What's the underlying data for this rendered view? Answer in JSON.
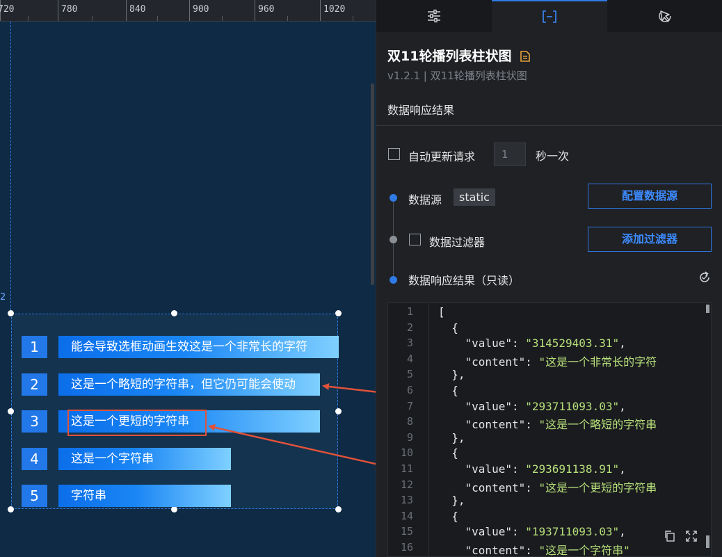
{
  "ruler": {
    "ticks": [
      "720",
      "780",
      "840",
      "900",
      "960",
      "1020"
    ],
    "side_label": "2"
  },
  "chart_data": {
    "type": "bar",
    "title": "",
    "categories": [
      "1",
      "2",
      "3",
      "4",
      "5"
    ],
    "labels": [
      "能会导致选框动画生效这是一个非常长的字符",
      "这是一个略短的字符串，但它仍可能会使动",
      "这是一个更短的字符串",
      "这是一个字符串",
      "字符串"
    ],
    "values": [
      314529403.31,
      293711093.03,
      293691138.91,
      193711093.03,
      193711093.03
    ]
  },
  "panel": {
    "tabs": [
      {
        "name": "style",
        "icon": "sliders-icon"
      },
      {
        "name": "data",
        "icon": "data-bracket-icon"
      },
      {
        "name": "interaction",
        "icon": "cursor-icon"
      }
    ],
    "title": "双11轮播列表柱状图",
    "subtitle": "v1.2.1 | 双11轮播列表柱状图",
    "section_title": "数据响应结果",
    "auto_update_label": "自动更新请求",
    "auto_update_value": "1",
    "auto_update_unit": "秒一次",
    "datasource_label": "数据源",
    "datasource_tag": "static",
    "config_datasource_btn": "配置数据源",
    "filter_label": "数据过滤器",
    "add_filter_btn": "添加过滤器",
    "response_label": "数据响应结果（只读）",
    "colors": {
      "accent": "#2f7ae5",
      "string": "#b7e07a"
    }
  },
  "code_lines": [
    {
      "n": "1",
      "parts": [
        {
          "t": "[",
          "c": "k"
        }
      ]
    },
    {
      "n": "2",
      "parts": [
        {
          "t": "  {",
          "c": "k"
        }
      ]
    },
    {
      "n": "3",
      "parts": [
        {
          "t": "    \"value\": ",
          "c": "k"
        },
        {
          "t": "\"314529403.31\"",
          "c": "s"
        },
        {
          "t": ",",
          "c": "k"
        }
      ]
    },
    {
      "n": "4",
      "parts": [
        {
          "t": "    \"content\": ",
          "c": "k"
        },
        {
          "t": "\"这是一个非常长的字符",
          "c": "s"
        }
      ]
    },
    {
      "n": "5",
      "parts": [
        {
          "t": "  },",
          "c": "k"
        }
      ]
    },
    {
      "n": "6",
      "parts": [
        {
          "t": "  {",
          "c": "k"
        }
      ]
    },
    {
      "n": "7",
      "parts": [
        {
          "t": "    \"value\": ",
          "c": "k"
        },
        {
          "t": "\"293711093.03\"",
          "c": "s"
        },
        {
          "t": ",",
          "c": "k"
        }
      ]
    },
    {
      "n": "8",
      "parts": [
        {
          "t": "    \"content\": ",
          "c": "k"
        },
        {
          "t": "\"这是一个略短的字符串",
          "c": "s"
        }
      ]
    },
    {
      "n": "9",
      "parts": [
        {
          "t": "  },",
          "c": "k"
        }
      ]
    },
    {
      "n": "10",
      "parts": [
        {
          "t": "  {",
          "c": "k"
        }
      ]
    },
    {
      "n": "11",
      "parts": [
        {
          "t": "    \"value\": ",
          "c": "k"
        },
        {
          "t": "\"293691138.91\"",
          "c": "s"
        },
        {
          "t": ",",
          "c": "k"
        }
      ]
    },
    {
      "n": "12",
      "parts": [
        {
          "t": "    \"content\": ",
          "c": "k"
        },
        {
          "t": "\"这是一个更短的字符串",
          "c": "s"
        }
      ]
    },
    {
      "n": "13",
      "parts": [
        {
          "t": "  },",
          "c": "k"
        }
      ]
    },
    {
      "n": "14",
      "parts": [
        {
          "t": "  {",
          "c": "k"
        }
      ]
    },
    {
      "n": "15",
      "parts": [
        {
          "t": "    \"value\": ",
          "c": "k"
        },
        {
          "t": "\"193711093.03\"",
          "c": "s"
        },
        {
          "t": ",",
          "c": "k"
        }
      ]
    },
    {
      "n": "16",
      "parts": [
        {
          "t": "    \"content\": ",
          "c": "k"
        },
        {
          "t": "\"这是一个字符串\"",
          "c": "s"
        }
      ]
    }
  ]
}
